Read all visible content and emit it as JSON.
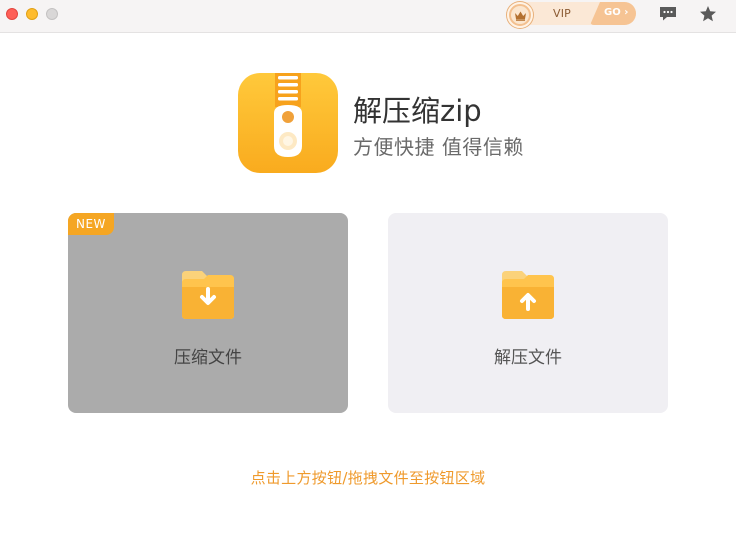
{
  "titlebar": {
    "vip_label": "VIP",
    "go_label": "GO",
    "icons": [
      "close-button",
      "minimize-button",
      "maximize-button",
      "crown-icon",
      "message-icon",
      "star-icon"
    ]
  },
  "app": {
    "title": "解压缩zip",
    "subtitle": "方便快捷 值得信赖"
  },
  "cards": {
    "compress": {
      "label": "压缩文件",
      "badge": "NEW"
    },
    "extract": {
      "label": "解压文件"
    }
  },
  "hint": "点击上方按钮/拖拽文件至按钮区域",
  "colors": {
    "accent": "#f5a623",
    "hint": "#ef9a2c",
    "compress_card": "#ababab",
    "extract_card": "#f0eff3"
  }
}
